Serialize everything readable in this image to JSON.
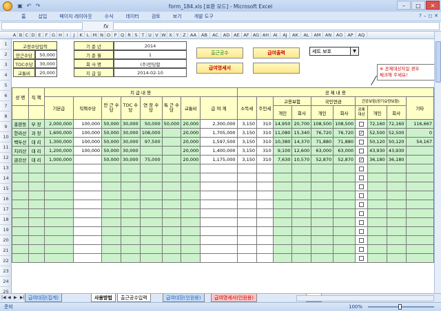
{
  "window": {
    "title": "form_184.xls  [호환 모드] - Microsoft Excel",
    "qat_icons": [
      "save-icon",
      "undo-icon",
      "redo-icon"
    ]
  },
  "ribbon": {
    "tabs": [
      "홈",
      "삽입",
      "페이지 레이아웃",
      "수식",
      "데이터",
      "검토",
      "보기",
      "개발 도구"
    ]
  },
  "formula_bar": {
    "fx": "fx",
    "namebox": "",
    "content": ""
  },
  "columns": [
    "A",
    "B",
    "C",
    "D",
    "E",
    "F",
    "G",
    "H",
    "I",
    "J",
    "K",
    "L",
    "M",
    "N",
    "O",
    "P",
    "Q",
    "R",
    "S",
    "T",
    "U",
    "V",
    "W",
    "X",
    "Y",
    "Z",
    "AA",
    "AB",
    "AC",
    "AD",
    "AE",
    "AF",
    "AG",
    "AH",
    "AI",
    "AJ",
    "AK",
    "AL",
    "AM",
    "AN",
    "AO",
    "AP",
    "AQ"
  ],
  "rows": [
    "1",
    "2",
    "3",
    "4",
    "5",
    "6",
    "7",
    "8",
    "9",
    "10",
    "11",
    "12",
    "13",
    "14",
    "15",
    "16",
    "17",
    "18",
    "19",
    "20",
    "21",
    "22",
    "23",
    "24",
    "25"
  ],
  "info": {
    "r1_label": "고정수당입력",
    "r2_label": "만근수당",
    "r2_value": "50,000",
    "r3_label": "TOC수당",
    "r3_value": "30,000",
    "r4_label": "교통비",
    "r4_value": "20,000",
    "g1_label": "기 준 년",
    "g1_value": "2014",
    "g2_label": "기 준 월",
    "g2_value": "1",
    "g3_label": "회 사 명",
    "g3_value": "(주)만당합",
    "g4_label": "지 급 일",
    "g4_value": "2014-02-10"
  },
  "buttons": {
    "b1": "출근공수",
    "b2": "급여출력",
    "b3": "급여명세서",
    "b4": "",
    "select_value": "세트 보호"
  },
  "note": {
    "line1": "※ 공제대상자일 경우",
    "line2": "체크해 주세요!"
  },
  "table": {
    "h_group1": "지 급 내 용",
    "h_group2": "공 제 내 용",
    "h_name": "성 명",
    "h_rank": "직 책",
    "h_base": "기본급",
    "h_pos": "직책수당",
    "h_full": "만 근 수 당",
    "h_toc": "TOC 수 당",
    "h_over": "연 장 수 당",
    "h_extra": "특 근 수 당",
    "h_trans": "교통비",
    "h_total": "급 여 계",
    "h_income": "소득세",
    "h_resident": "주민세",
    "h_emp": "고용보험",
    "h_pension": "국민연금",
    "h_health": "건강보험(장기요양보험)",
    "h_personal": "개인",
    "h_company": "회사",
    "h_personal2": "개인",
    "h_company2": "회사",
    "h_target": "공제 대상",
    "h_personal3": "개인",
    "h_company3": "회사",
    "h_other": "기타",
    "rows": [
      [
        "홍판동",
        "부 장",
        "2,000,000",
        "100,000",
        "50,000",
        "30,000",
        "50,000",
        "50,000",
        "20,000",
        "2,300,000",
        "3,150",
        "310",
        "14,950",
        "20,700",
        "108,500",
        "108,500",
        "false",
        "72,160",
        "72,160",
        "116,667"
      ],
      [
        "한라산",
        "과 장",
        "1,600,000",
        "100,000",
        "50,000",
        "30,000",
        "108,000",
        "",
        "20,000",
        "1,705,000",
        "3,150",
        "310",
        "11,080",
        "15,340",
        "76,720",
        "76,720",
        "true",
        "52,500",
        "52,500",
        "0"
      ],
      [
        "백두산",
        "대 리",
        "1,300,000",
        "100,000",
        "50,000",
        "30,000",
        "97,500",
        "",
        "20,000",
        "1,597,500",
        "3,150",
        "310",
        "10,380",
        "14,370",
        "71,880",
        "71,880",
        "false",
        "50,120",
        "50,120",
        "54,167"
      ],
      [
        "지리산",
        "대 리",
        "1,200,000",
        "100,000",
        "50,000",
        "30,000",
        "",
        "",
        "20,000",
        "1,400,000",
        "3,150",
        "310",
        "9,100",
        "12,600",
        "63,000",
        "63,000",
        "false",
        "43,930",
        "43,930",
        ""
      ],
      [
        "금강산",
        "대 리",
        "1,000,000",
        "",
        "50,000",
        "30,000",
        "75,000",
        "",
        "20,000",
        "1,175,000",
        "3,150",
        "310",
        "7,630",
        "10,570",
        "52,870",
        "52,870",
        "true",
        "36,180",
        "36,180",
        ""
      ]
    ]
  },
  "sheet_tabs": [
    "급여대장(집계)",
    "사용방법",
    "출근공수입력",
    "급여대장(인원용)",
    "급여명세서(인원용)",
    "국민"
  ],
  "status": {
    "ready": "준비",
    "zoom": "100%"
  }
}
